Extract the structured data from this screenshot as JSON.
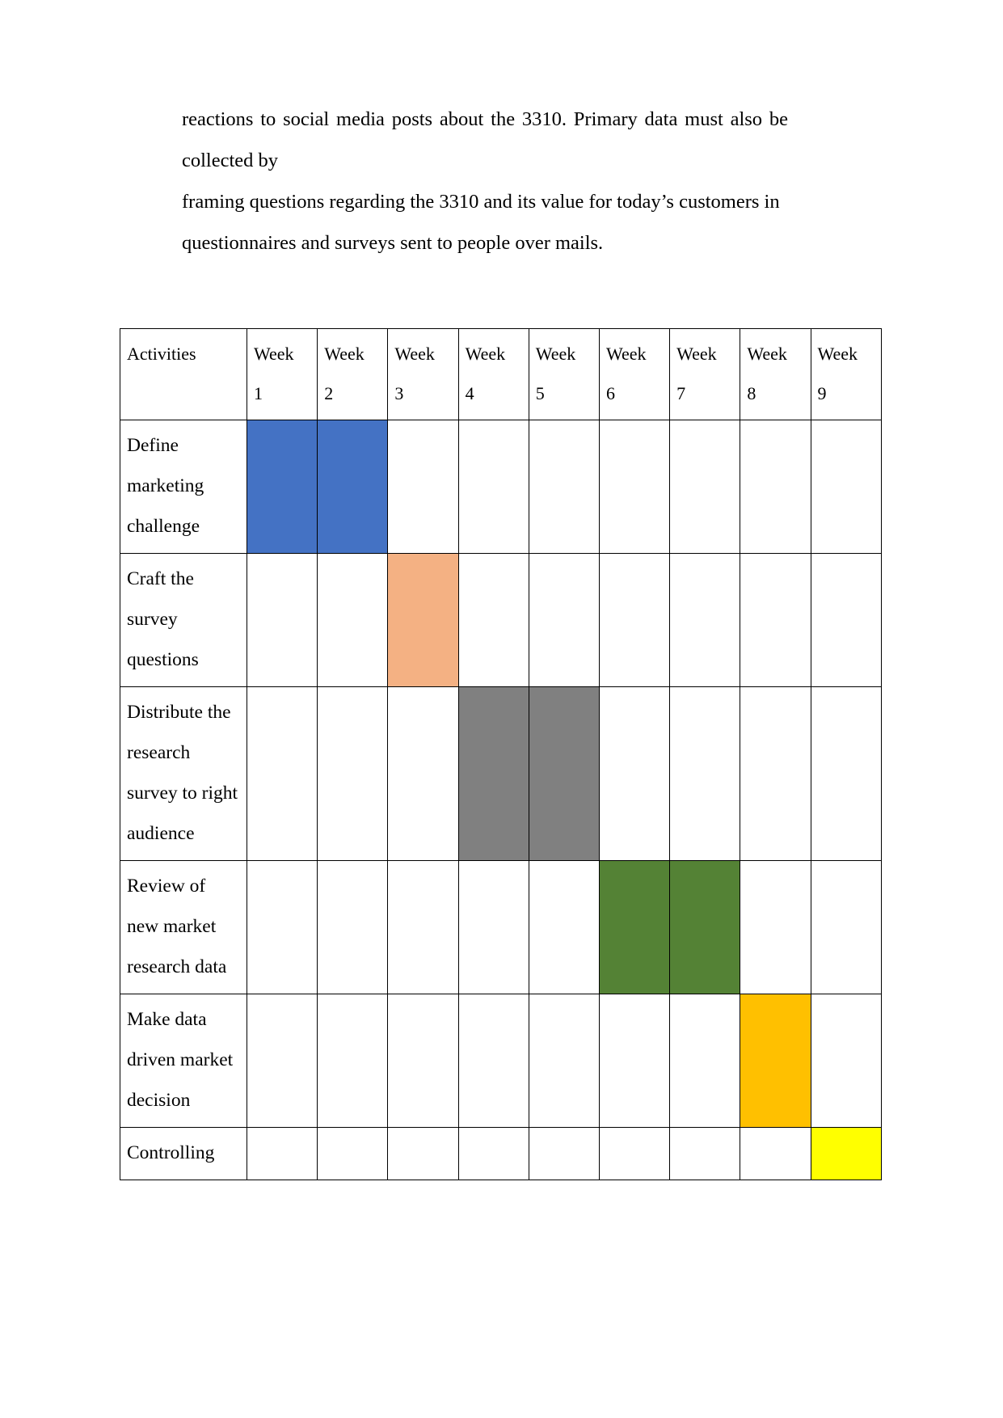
{
  "document": {
    "paragraph": {
      "lines": [
        "reactions to social media posts about the 3310. Primary data must also be collected by",
        "framing questions regarding the 3310 and its value for today’s customers in",
        "questionnaires and surveys sent to people over mails."
      ],
      "full_text": "reactions to social media posts about the 3310. Primary data must also be collected by framing questions regarding the 3310 and its value for today’s customers in questionnaires and surveys sent to people over mails."
    }
  },
  "chart_data": {
    "type": "table",
    "title": "",
    "column_header_first": "Activities",
    "week_label": "Week",
    "week_numbers": [
      "1",
      "2",
      "3",
      "4",
      "5",
      "6",
      "7",
      "8",
      "9"
    ],
    "categories": [
      "Week 1",
      "Week 2",
      "Week 3",
      "Week 4",
      "Week 5",
      "Week 6",
      "Week 7",
      "Week 8",
      "Week 9"
    ],
    "colors": {
      "define_marketing_challenge": "#4472C4",
      "craft_the_survey_questions": "#F4B183",
      "distribute_the_research_survey": "#808080",
      "review_of_new_market_research_data": "#548235",
      "make_data_driven_market_decision": "#FFC000",
      "controlling": "#FFFF00",
      "grid_line": "#000000",
      "cell_background": "#FFFFFF",
      "text": "#000000"
    },
    "rows": [
      {
        "activity": "Define marketing challenge",
        "color": "#4472C4",
        "filled_weeks": [
          1,
          2
        ],
        "cells": [
          true,
          true,
          false,
          false,
          false,
          false,
          false,
          false,
          false
        ]
      },
      {
        "activity": "Craft the survey questions",
        "color": "#F4B183",
        "filled_weeks": [
          3
        ],
        "cells": [
          false,
          false,
          true,
          false,
          false,
          false,
          false,
          false,
          false
        ]
      },
      {
        "activity": "Distribute the research survey to right audience",
        "color": "#808080",
        "filled_weeks": [
          4,
          5
        ],
        "cells": [
          false,
          false,
          false,
          true,
          true,
          false,
          false,
          false,
          false
        ]
      },
      {
        "activity": "Review of new market research data",
        "color": "#548235",
        "filled_weeks": [
          6,
          7
        ],
        "cells": [
          false,
          false,
          false,
          false,
          false,
          true,
          true,
          false,
          false
        ]
      },
      {
        "activity": "Make data driven market decision",
        "color": "#FFC000",
        "filled_weeks": [
          8
        ],
        "cells": [
          false,
          false,
          false,
          false,
          false,
          false,
          false,
          true,
          false
        ]
      },
      {
        "activity": "Controlling",
        "color": "#FFFF00",
        "filled_weeks": [
          9
        ],
        "cells": [
          false,
          false,
          false,
          false,
          false,
          false,
          false,
          false,
          true
        ]
      }
    ]
  }
}
